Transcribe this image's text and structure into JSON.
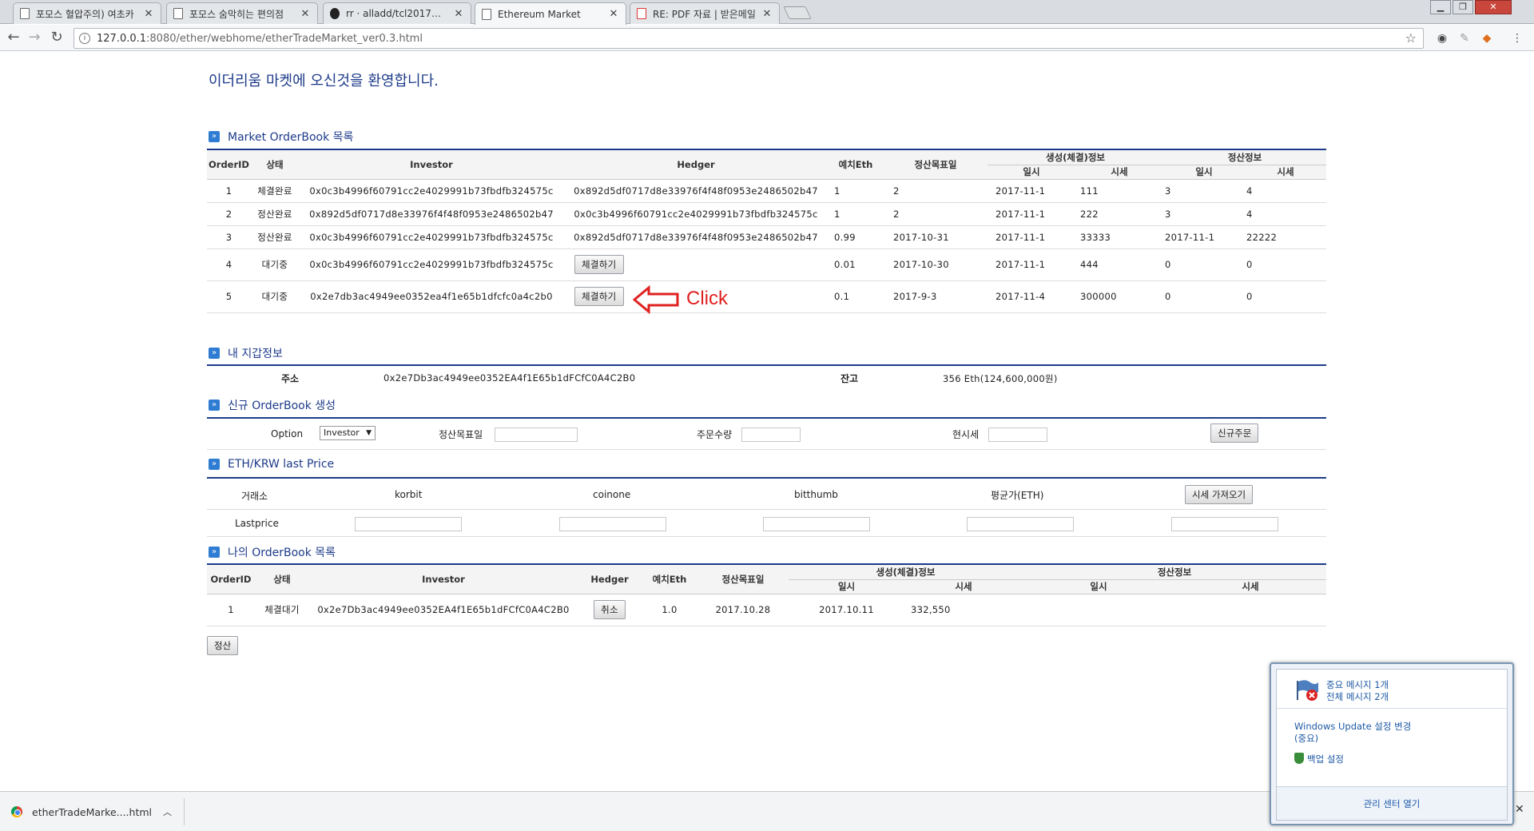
{
  "browser": {
    "tabs": [
      {
        "label": "포모스 혈압주의) 여초카",
        "icon": "page-icon"
      },
      {
        "label": "포모스 숨막히는 편의점",
        "icon": "page-icon"
      },
      {
        "label": "rr · alladd/tcl2017@fbd",
        "icon": "github-icon"
      },
      {
        "label": "Ethereum Market",
        "icon": "page-icon"
      },
      {
        "label": "RE: PDF 자료 | 받은메일",
        "icon": "mail-icon"
      }
    ],
    "url_host": "127.0.0.1",
    "url_rest": ":8080/ether/webhome/etherTradeMarket_ver0.3.html"
  },
  "page": {
    "welcome": "이더리움 마켓에 오신것을 환영합니다."
  },
  "market_orderbook": {
    "title": "Market OrderBook 목록",
    "headers": {
      "order_id": "OrderID",
      "status": "상태",
      "investor": "Investor",
      "hedger": "Hedger",
      "deposit": "예치Eth",
      "target_date": "정산목표일",
      "create_info": "생성(체결)정보",
      "settle_info": "정산정보",
      "date": "일시",
      "price": "시세"
    },
    "rows": [
      {
        "id": "1",
        "status": "체결완료",
        "investor": "0x0c3b4996f60791cc2e4029991b73fbdfb324575c",
        "hedger": "0x892d5df0717d8e33976f4f48f0953e2486502b47",
        "deposit": "1",
        "target": "2",
        "create_date": "2017-11-1",
        "create_price": "111",
        "settle_date": "3",
        "settle_price": "4"
      },
      {
        "id": "2",
        "status": "정산완료",
        "investor": "0x892d5df0717d8e33976f4f48f0953e2486502b47",
        "hedger": "0x0c3b4996f60791cc2e4029991b73fbdfb324575c",
        "deposit": "1",
        "target": "2",
        "create_date": "2017-11-1",
        "create_price": "222",
        "settle_date": "3",
        "settle_price": "4"
      },
      {
        "id": "3",
        "status": "정산완료",
        "investor": "0x0c3b4996f60791cc2e4029991b73fbdfb324575c",
        "hedger": "0x892d5df0717d8e33976f4f48f0953e2486502b47",
        "deposit": "0.99",
        "target": "2017-10-31",
        "create_date": "2017-11-1",
        "create_price": "33333",
        "settle_date": "2017-11-1",
        "settle_price": "22222"
      },
      {
        "id": "4",
        "status": "대기중",
        "investor": "0x0c3b4996f60791cc2e4029991b73fbdfb324575c",
        "hedger_button": "체결하기",
        "deposit": "0.01",
        "target": "2017-10-30",
        "create_date": "2017-11-1",
        "create_price": "444",
        "settle_date": "0",
        "settle_price": "0"
      },
      {
        "id": "5",
        "status": "대기중",
        "investor": "0x2e7db3ac4949ee0352ea4f1e65b1dfcfc0a4c2b0",
        "hedger_button": "체결하기",
        "deposit": "0.1",
        "target": "2017-9-3",
        "create_date": "2017-11-4",
        "create_price": "300000",
        "settle_date": "0",
        "settle_price": "0"
      }
    ],
    "annotation": "Click"
  },
  "wallet": {
    "title": "내 지갑정보",
    "address_label": "주소",
    "address": "0x2e7Db3ac4949ee0352EA4f1E65b1dFCfC0A4C2B0",
    "balance_label": "잔고",
    "balance": "356 Eth(124,600,000원)"
  },
  "new_order": {
    "title": "신규 OrderBook 생성",
    "option_label": "Option",
    "option_selected": "Investor",
    "target_label": "정산목표일",
    "qty_label": "주문수량",
    "price_label": "현시세",
    "submit": "신규주문"
  },
  "last_price": {
    "title": "ETH/KRW last Price",
    "exchange_label": "거래소",
    "exchanges": [
      "korbit",
      "coinone",
      "bitthumb",
      "평균가(ETH)"
    ],
    "fetch_button": "시세 가져오기",
    "lastprice_label": "Lastprice"
  },
  "my_orderbook": {
    "title": "나의 OrderBook 목록",
    "headers": {
      "order_id": "OrderID",
      "status": "상태",
      "investor": "Investor",
      "hedger": "Hedger",
      "deposit": "예치Eth",
      "target_date": "정산목표일",
      "create_info": "생성(체결)정보",
      "settle_info": "정산정보",
      "date": "일시",
      "price": "시세"
    },
    "row": {
      "id": "1",
      "status": "체결대기",
      "investor": "0x2e7Db3ac4949ee0352EA4f1E65b1dFCfC0A4C2B0",
      "cancel": "취소",
      "deposit": "1.0",
      "target": "2017.10.28",
      "create_date": "2017.10.11",
      "create_price": "332,550"
    },
    "settle_button": "정산"
  },
  "download": {
    "filename": "etherTradeMarke....html"
  },
  "notification": {
    "important": "중요 메시지 1개",
    "total": "전체 메시지 2개",
    "update_link": "Windows Update 설정 변경",
    "update_note": "(중요)",
    "backup_link": "백업 설정",
    "open_center": "관리 센터 열기"
  },
  "colors": {
    "accent": "#1d3b8a",
    "annotation": "#e02020",
    "bullet": "#2f7cd3"
  }
}
